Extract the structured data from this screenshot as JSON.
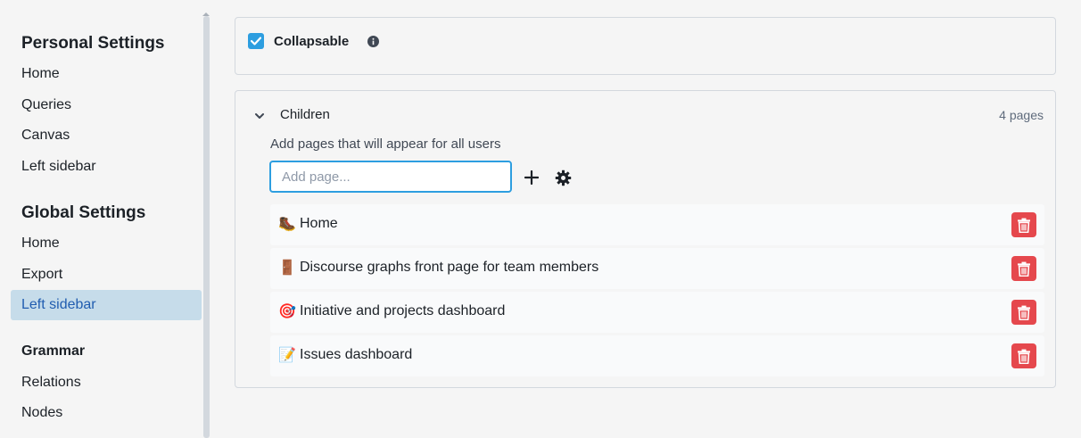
{
  "sidebar": {
    "personal_title": "Personal Settings",
    "personal_items": [
      "Home",
      "Queries",
      "Canvas",
      "Left sidebar"
    ],
    "global_title": "Global Settings",
    "global_items": [
      "Home",
      "Export",
      "Left sidebar"
    ],
    "grammar_title": "Grammar",
    "grammar_items": [
      "Relations",
      "Nodes"
    ],
    "active_item": "Global Settings / Left sidebar"
  },
  "collapsable": {
    "checked": true,
    "label": "Collapsable",
    "info_icon": "info-icon"
  },
  "children": {
    "label": "Children",
    "count": "4 pages",
    "description": "Add pages that will appear for all users",
    "input_placeholder": "Add page...",
    "input_value": "",
    "pages": [
      {
        "emoji": "🥾",
        "label": "Home"
      },
      {
        "emoji": "🚪",
        "label": "Discourse graphs front page for team members"
      },
      {
        "emoji": "🎯",
        "label": "Initiative and projects dashboard"
      },
      {
        "emoji": "📝",
        "label": "Issues dashboard"
      }
    ]
  },
  "colors": {
    "accent": "#2d9ee0",
    "active_bg": "#c6dcea",
    "active_text": "#215db0",
    "danger": "#e5484d"
  }
}
